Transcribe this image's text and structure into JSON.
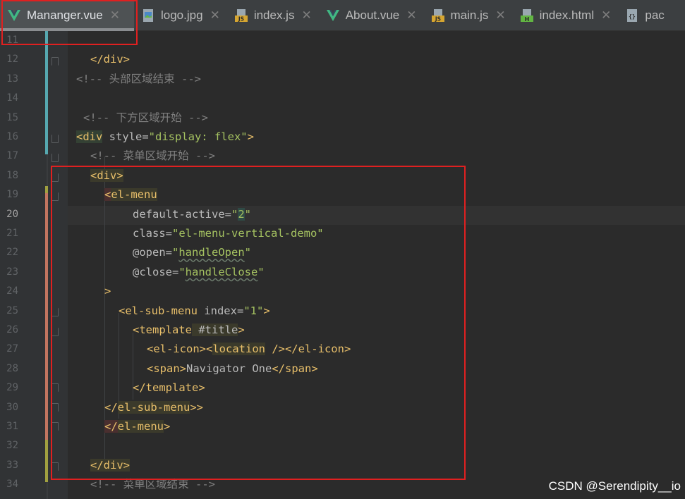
{
  "tabs": [
    {
      "label": "Mananger.vue",
      "icon": "vue-file-icon",
      "active": true
    },
    {
      "label": "logo.jpg",
      "icon": "image-file-icon"
    },
    {
      "label": "index.js",
      "icon": "js-file-icon"
    },
    {
      "label": "About.vue",
      "icon": "vue-file-icon"
    },
    {
      "label": "main.js",
      "icon": "js-file-icon"
    },
    {
      "label": "index.html",
      "icon": "html-file-icon"
    },
    {
      "label": "pac",
      "icon": "json-file-icon"
    }
  ],
  "tab_close_glyph": "✕",
  "icon_glyphs": {
    "js": "JS",
    "html": "H",
    "json": "{}"
  },
  "line_numbers": [
    "11",
    "12",
    "13",
    "14",
    "15",
    "16",
    "17",
    "18",
    "19",
    "20",
    "21",
    "22",
    "23",
    "24",
    "25",
    "26",
    "27",
    "28",
    "29",
    "30",
    "31",
    "32",
    "33",
    "34"
  ],
  "current_line": "20",
  "code": {
    "l12": "</div>",
    "l13": "<!-- 头部区域结束 -->",
    "l15": "<!-- 下方区域开始 -->",
    "l16_tag": "<div",
    "l16_attr": " style=",
    "l16_val": "\"display: flex\"",
    "l16_end": ">",
    "l17": "<!-- 菜单区域开始 -->",
    "l18": "<div>",
    "l19_lt": "<",
    "l19_name": "el-menu",
    "l20_attr": "default-active=",
    "l20_q1": "\"",
    "l20_num": "2",
    "l20_q2": "\"",
    "l21_attr": "class=",
    "l21_val": "\"el-menu-vertical-demo\"",
    "l22_attr": "@open=",
    "l22_q1": "\"",
    "l22_val": "handleOpen",
    "l22_q2": "\"",
    "l23_attr": "@close=",
    "l23_q1": "\"",
    "l23_val": "handleClose",
    "l23_q2": "\"",
    "l24": ">",
    "l25_tag": "<el-sub-menu",
    "l25_attr": " index=",
    "l25_val": "\"1\"",
    "l25_end": ">",
    "l26_tag": "<template",
    "l26_attr": " #title",
    "l26_end": ">",
    "l27_open": "<el-icon><",
    "l27_loc": "location",
    "l27_close": " /></el-icon>",
    "l28_open": "<span>",
    "l28_text": "Navigator One",
    "l28_close": "</span>",
    "l29": "</template>",
    "l30_lt": "</",
    "l30_name": "el-sub-menu",
    "l30_end": ">>",
    "l31_lt": "</",
    "l31_name": "el-menu",
    "l31_end": ">",
    "l33": "</div>",
    "l34": "<!-- 菜单区域结束 -->"
  },
  "watermark": "CSDN @Serendipity__io",
  "colors": {
    "tag": "#e8bf6a",
    "string": "#a5c261",
    "comment": "#808080",
    "annotation": "#e02020"
  }
}
